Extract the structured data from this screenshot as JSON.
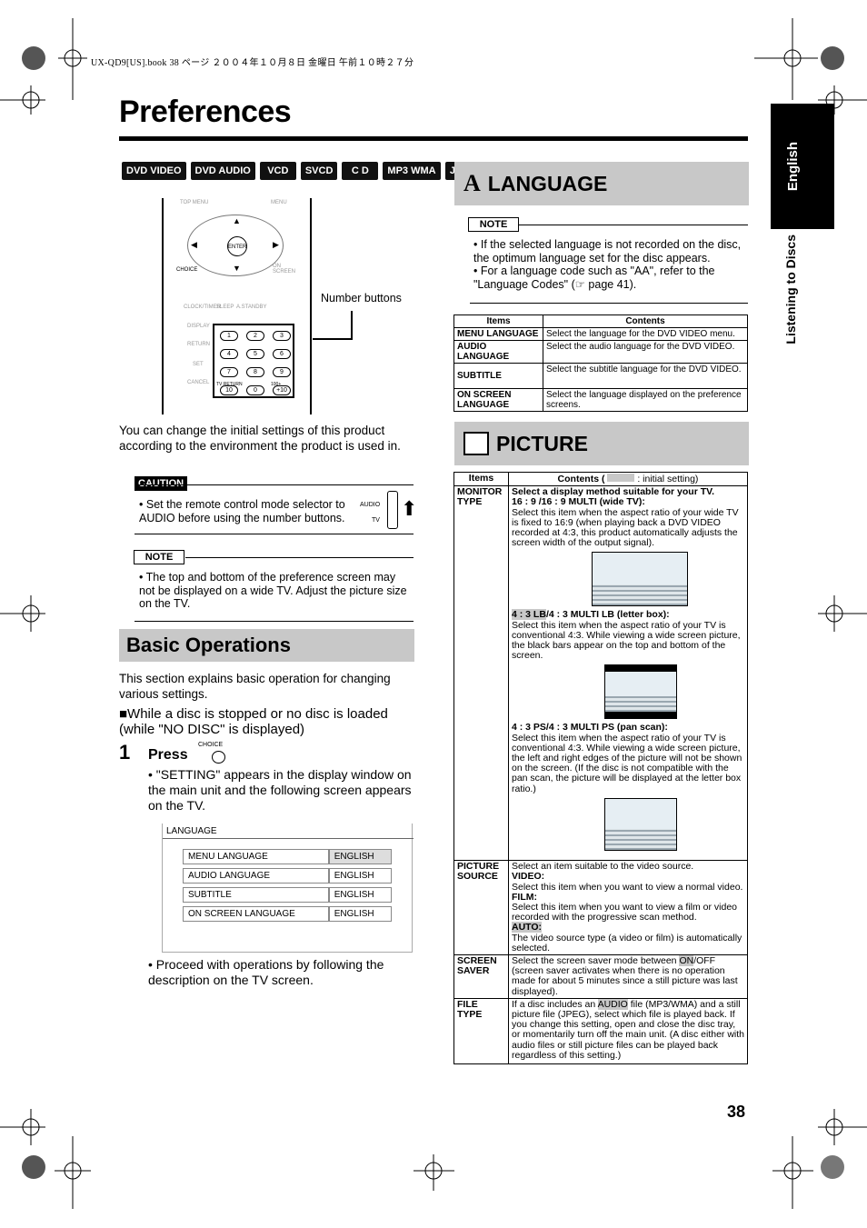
{
  "header": {
    "book_info": "UX-QD9[US].book  38 ページ  ２００４年１０月８日  金曜日  午前１０時２７分"
  },
  "page": {
    "title": "Preferences",
    "number": "38"
  },
  "side_tab": {
    "language": "English",
    "section": "Listening to Discs"
  },
  "badges": [
    "DVD VIDEO",
    "DVD AUDIO",
    "VCD",
    "SVCD",
    "C D",
    "MP3 WMA",
    "JPEG"
  ],
  "remote": {
    "callout": "Number buttons",
    "labels": {
      "top_menu": "TOP MENU",
      "menu": "MENU",
      "enter": "ENTER",
      "choice": "CHOICE",
      "on_screen": "ON SCREEN",
      "clock": "CLOCK/TIMER",
      "sleep": "SLEEP",
      "astandby": "A.STANDBY",
      "display": "DISPLAY",
      "return": "RETURN",
      "set": "SET",
      "cancel": "CANCEL",
      "tv_return": "TV RETURN",
      "plus100": "100+"
    },
    "keys": [
      "1",
      "2",
      "3",
      "4",
      "5",
      "6",
      "7",
      "8",
      "9",
      "10",
      "0",
      "+10"
    ]
  },
  "intro": "You can change the initial settings of this product according to the environment the product is used in.",
  "caution": {
    "label": "CAUTION",
    "text": "Set the remote control mode selector to AUDIO before using the number buttons.",
    "switch_top": "AUDIO",
    "switch_bottom": "TV"
  },
  "note1": {
    "label": "NOTE",
    "text": "The top and bottom of the preference screen may not be displayed on a wide TV. Adjust the picture size on the TV."
  },
  "basic": {
    "heading": "Basic Operations",
    "desc": "This section explains basic operation for changing various settings.",
    "condition": "■While a disc is stopped or no disc is loaded (while \"NO DISC\" is displayed)",
    "step_num": "1",
    "step_press": "Press",
    "choice_label": "CHOICE",
    "bullet1": "\"SETTING\" appears in the display window on the main unit and the following screen appears on the TV.",
    "bullet2": "Proceed with operations by following the description on the TV screen."
  },
  "screen": {
    "tab": "LANGUAGE",
    "rows": [
      [
        "MENU LANGUAGE",
        "ENGLISH"
      ],
      [
        "AUDIO LANGUAGE",
        "ENGLISH"
      ],
      [
        "SUBTITLE",
        "ENGLISH"
      ],
      [
        "ON SCREEN LANGUAGE",
        "ENGLISH"
      ]
    ]
  },
  "language": {
    "heading": "LANGUAGE",
    "note_label": "NOTE",
    "notes": [
      "If the selected language is not recorded on the disc, the optimum language set for the disc appears.",
      "For a language code such as \"AA\", refer to the \"Language Codes\" (☞ page 41)."
    ],
    "headers": [
      "Items",
      "Contents"
    ],
    "rows": [
      [
        "MENU LANGUAGE",
        "Select the language for the DVD VIDEO menu."
      ],
      [
        "AUDIO LANGUAGE",
        "Select the audio language for the DVD VIDEO."
      ],
      [
        "SUBTITLE",
        "Select the subtitle language for the DVD VIDEO."
      ],
      [
        "ON SCREEN LANGUAGE",
        "Select the language displayed on the preference screens."
      ]
    ]
  },
  "picture": {
    "heading": "PICTURE",
    "headers": {
      "items": "Items",
      "contents_pre": "Contents (",
      "contents_post": ": initial setting)"
    },
    "monitor": {
      "item": "MONITOR TYPE",
      "intro": "Select a display method suitable for your TV.",
      "o1_title": "16 : 9 /16 : 9 MULTI (wide TV):",
      "o1_text": "Select this item when the aspect ratio of your wide TV is fixed to 16:9 (when playing back a DVD VIDEO recorded at 4:3, this product automatically adjusts the screen width of the output signal).",
      "o2_hl": "4 : 3 LB",
      "o2_title": "/4 : 3 MULTI LB (letter box):",
      "o2_text": "Select this item when the aspect ratio of your TV is conventional 4:3. While viewing a wide screen picture, the black bars appear on the top and bottom of the screen.",
      "o3_title": "4 : 3 PS/4 : 3 MULTI PS (pan scan):",
      "o3_text": "Select this item when the aspect ratio of your TV is conventional 4:3. While viewing a wide screen picture, the left and right edges of the picture will not be shown on the screen. (If the disc is not compatible with the pan scan, the picture will be displayed at the letter box ratio.)"
    },
    "source": {
      "item": "PICTURE SOURCE",
      "intro": "Select an item suitable to the video source.",
      "v": "VIDEO:",
      "v_text": "Select this item when you want to view a normal video.",
      "f": "FILM:",
      "f_text": "Select this item when you want to view a film or video recorded with the progressive scan method.",
      "a": "AUTO:",
      "a_text": "The video source type (a video or film) is automatically selected."
    },
    "saver": {
      "item": "SCREEN SAVER",
      "pre": "Select the screen saver mode between ",
      "on": "ON",
      "post": "/OFF (screen saver activates when there is no operation made for about 5 minutes since a still picture was last displayed)."
    },
    "file": {
      "item": "FILE TYPE",
      "pre": "If a disc includes an ",
      "audio": "AUDIO",
      "post": " file (MP3/WMA) and a still picture file (JPEG), select which file is played back. If you change this setting, open and close the disc tray, or momentarily turn off the main unit. (A disc either with audio files or still picture files can be played back regardless of this setting.)"
    }
  },
  "colors": {
    "section_bar": "#c8c8c8",
    "tab_bg": "#000000"
  }
}
